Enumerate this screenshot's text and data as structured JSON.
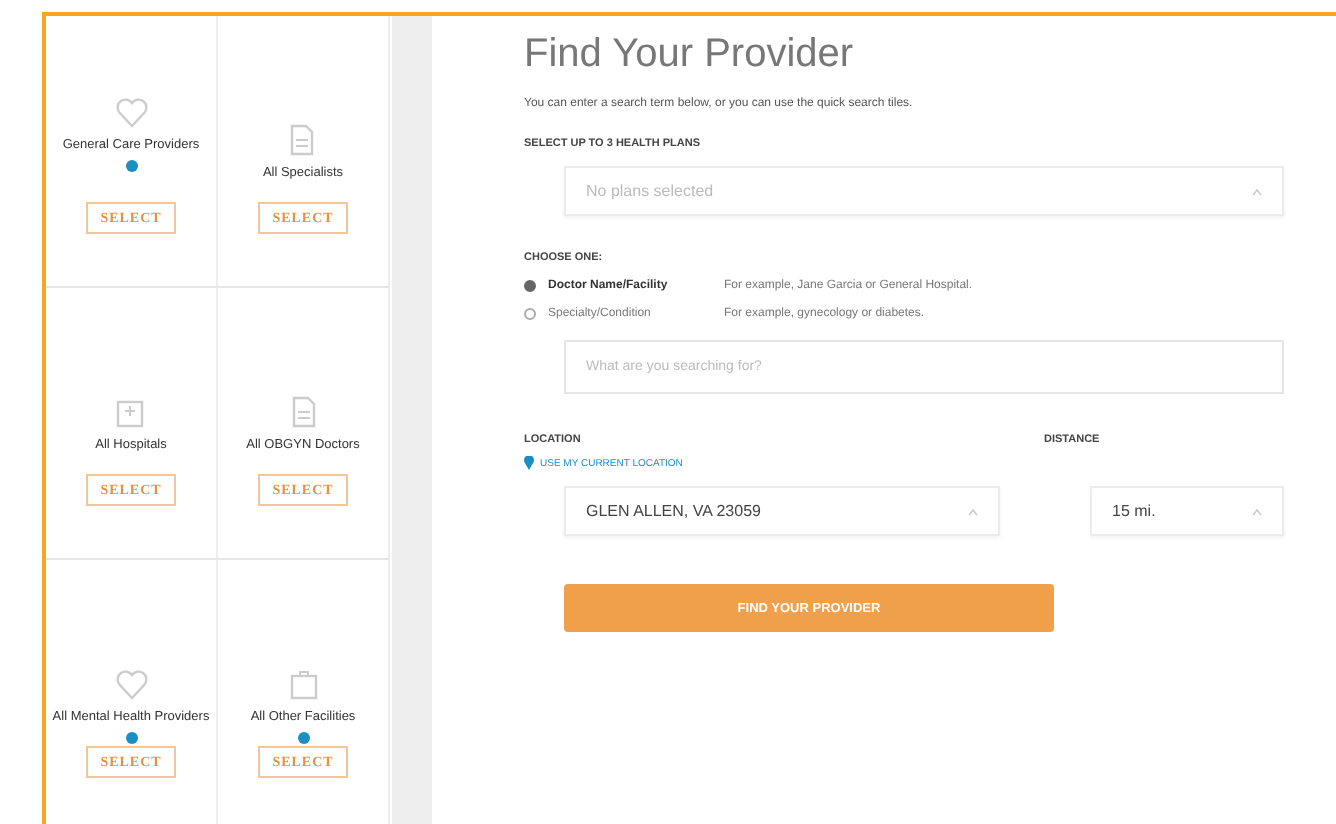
{
  "tiles": [
    {
      "kind": "heart",
      "label": "General Care Providers",
      "info_dot": true,
      "button": "SELECT"
    },
    {
      "kind": "document",
      "label": "All Specialists",
      "info_dot": false,
      "button": "SELECT"
    },
    {
      "kind": "hospital",
      "label": "All Hospitals",
      "info_dot": false,
      "button": "SELECT"
    },
    {
      "kind": "document",
      "label": "All OBGYN Doctors",
      "info_dot": false,
      "button": "SELECT"
    },
    {
      "kind": "heart",
      "label": "All Mental Health Providers",
      "info_dot": true,
      "button": "SELECT"
    },
    {
      "kind": "briefcase",
      "label": "All Other Facilities",
      "info_dot": true,
      "button": "SELECT"
    }
  ],
  "form": {
    "title": "Find Your Provider",
    "intro": "You can enter a search term below, or you can use the quick search tiles.",
    "plans": {
      "label": "SELECT UP TO 3 HEALTH PLANS",
      "placeholder": "No plans selected"
    },
    "choose": {
      "label": "CHOOSE ONE:",
      "options": [
        {
          "label": "Doctor Name/Facility",
          "example": "For example, Jane Garcia or General Hospital.",
          "selected": true
        },
        {
          "label": "Specialty/Condition",
          "example": "For example, gynecology or diabetes.",
          "selected": false
        }
      ],
      "placeholder": "What are you searching for?"
    },
    "location": {
      "label": "LOCATION",
      "link": "USE MY CURRENT LOCATION",
      "value": "GLEN ALLEN, VA 23059"
    },
    "distance": {
      "label": "DISTANCE",
      "value": "15 mi."
    },
    "submit": "FIND YOUR PROVIDER"
  }
}
